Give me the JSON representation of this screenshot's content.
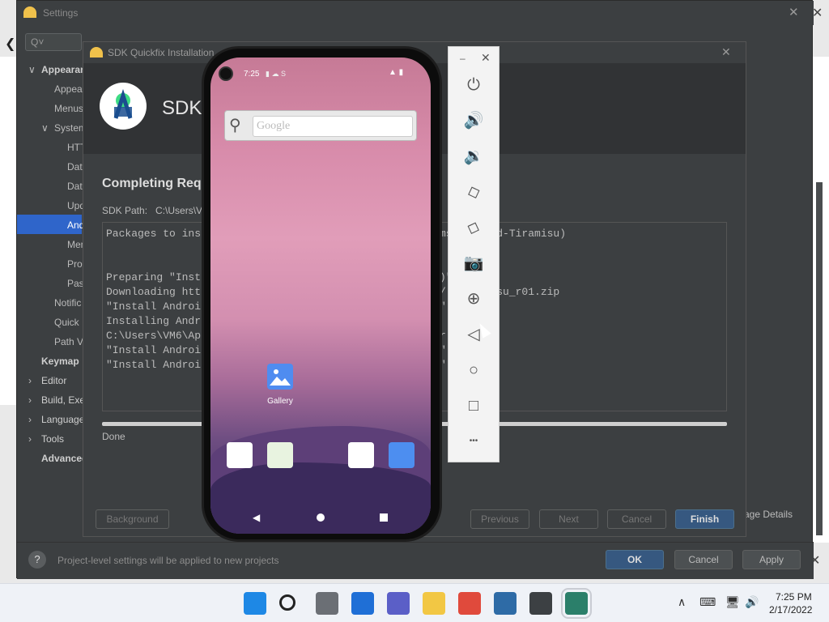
{
  "settings": {
    "title": "Settings",
    "search_placeholder": "Q˅",
    "tree": [
      {
        "label": "Appearan",
        "arrow": "∨"
      },
      {
        "label": "Appear"
      },
      {
        "label": "Menus"
      },
      {
        "label": "System",
        "arrow": "∨"
      },
      {
        "label": "HTT"
      },
      {
        "label": "Data"
      },
      {
        "label": "Date"
      },
      {
        "label": "Upd"
      },
      {
        "label": "And"
      },
      {
        "label": "Mem"
      },
      {
        "label": "Pro"
      },
      {
        "label": "Pas"
      },
      {
        "label": "Notific"
      },
      {
        "label": "Quick"
      },
      {
        "label": "Path V"
      },
      {
        "label": "Keymap"
      },
      {
        "label": "Editor",
        "arrow": "›"
      },
      {
        "label": "Build, Exe",
        "arrow": "›"
      },
      {
        "label": "Language",
        "arrow": "›"
      },
      {
        "label": "Tools",
        "arrow": "›"
      },
      {
        "label": "Advanced"
      }
    ],
    "hint": "Project-level settings will be applied to new projects",
    "ok_label": "OK",
    "cancel_label": "Cancel",
    "apply_label": "Apply",
    "usage_details": "age Details"
  },
  "quickfix": {
    "title": "SDK Quickfix Installation",
    "heading": "SDK",
    "section_title": "Completing Req",
    "sdk_path_label": "SDK Path:",
    "sdk_path_value": "C:\\Users\\VM",
    "log_left": [
      "Packages to ins",
      "",
      "",
      "Preparing \"Inst",
      "Downloading htt",
      "\"Install Androi",
      "Installing Andr",
      "C:\\Users\\VM6\\Ap",
      "\"Install Androi",
      "\"Install Androi"
    ],
    "log_right": [
      "ms;android-Tiramisu)",
      "",
      "",
      ")\".",
      "/ -Tiramisu_r01.zip",
      "\"",
      "",
      "r  amisu",
      "\" e.",
      "\" d."
    ],
    "status": "Done",
    "buttons": {
      "background": "Background",
      "previous": "Previous",
      "next": "Next",
      "cancel": "Cancel",
      "finish": "Finish"
    }
  },
  "phone": {
    "time": "7:25",
    "status_extra": "▮  ☁  S",
    "status_icons": "▲ ▮",
    "search_placeholder": "Google",
    "gallery_label": "Gallery",
    "dock": [
      {
        "name": "phone-app-icon",
        "color": "#ffffff"
      },
      {
        "name": "files-app-icon",
        "color": "#e8f3e0"
      },
      {
        "name": "android-app-icon",
        "color": "#ffffff"
      },
      {
        "name": "camera-app-icon",
        "color": "#4d8ef0"
      }
    ]
  },
  "emulator_toolbar": {
    "minimize": "–",
    "close": "✕",
    "tools": [
      {
        "name": "power-icon",
        "glyph": "⏻"
      },
      {
        "name": "volume-up-icon",
        "glyph": "🔊"
      },
      {
        "name": "volume-down-icon",
        "glyph": "🔉"
      },
      {
        "name": "rotate-left-icon",
        "glyph": "◇"
      },
      {
        "name": "rotate-right-icon",
        "glyph": "◇"
      },
      {
        "name": "camera-icon",
        "glyph": "📷"
      },
      {
        "name": "zoom-icon",
        "glyph": "⊕"
      },
      {
        "name": "back-icon",
        "glyph": "◁"
      },
      {
        "name": "home-icon",
        "glyph": "○"
      },
      {
        "name": "overview-icon",
        "glyph": "□"
      },
      {
        "name": "more-icon",
        "glyph": "•••"
      }
    ]
  },
  "taskbar": {
    "time": "7:25 PM",
    "date": "2/17/2022",
    "icons": [
      {
        "name": "start-icon",
        "color": "#1e88e5"
      },
      {
        "name": "search-icon",
        "color": "transparent"
      },
      {
        "name": "task-view-icon",
        "color": "#6b6f75"
      },
      {
        "name": "widgets-icon",
        "color": "#1f6fd6"
      },
      {
        "name": "chat-icon",
        "color": "#5b5fc7"
      },
      {
        "name": "file-explorer-icon",
        "color": "#f2c744"
      },
      {
        "name": "chrome-icon",
        "color": "#e04a3c"
      },
      {
        "name": "virtualbox-icon",
        "color": "#2e6ba6"
      },
      {
        "name": "android-studio-icon",
        "color": "#3c4043"
      },
      {
        "name": "emulator-icon",
        "color": "#2b7f6a"
      }
    ],
    "tray": [
      "∧",
      "⌨",
      "🖥",
      "🔊"
    ]
  }
}
